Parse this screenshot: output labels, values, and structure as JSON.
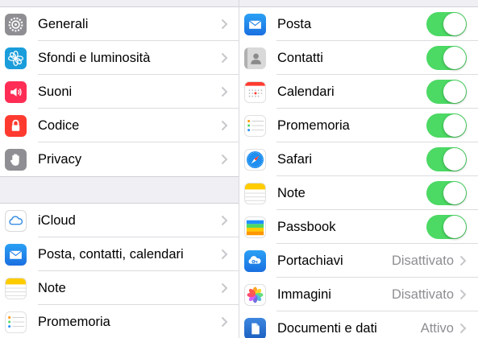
{
  "left": {
    "group1": [
      {
        "label": "Generali",
        "icon": "gear-icon",
        "color": "#8e8e93"
      },
      {
        "label": "Sfondi e luminosità",
        "icon": "flower-icon",
        "color": "#1a9ddb"
      },
      {
        "label": "Suoni",
        "icon": "speaker-icon",
        "color": "#ff2d55"
      },
      {
        "label": "Codice",
        "icon": "lock-icon",
        "color": "#ff3b30"
      },
      {
        "label": "Privacy",
        "icon": "hand-icon",
        "color": "#8e8e93"
      }
    ],
    "group2": [
      {
        "label": "iCloud",
        "icon": "cloud-icon",
        "color": "#ffffff"
      },
      {
        "label": "Posta, contatti, calendari",
        "icon": "mail-icon",
        "color": "#1e90ff"
      },
      {
        "label": "Note",
        "icon": "notes-icon",
        "color": "#ffcc00"
      },
      {
        "label": "Promemoria",
        "icon": "reminders-icon",
        "color": "#ffffff"
      }
    ]
  },
  "right": {
    "items": [
      {
        "label": "Posta",
        "icon": "mail-icon",
        "toggle": true
      },
      {
        "label": "Contatti",
        "icon": "contacts-icon",
        "toggle": true
      },
      {
        "label": "Calendari",
        "icon": "calendar-icon",
        "toggle": true
      },
      {
        "label": "Promemoria",
        "icon": "reminders-icon",
        "toggle": true
      },
      {
        "label": "Safari",
        "icon": "safari-icon",
        "toggle": true
      },
      {
        "label": "Note",
        "icon": "notes-icon",
        "toggle": true
      },
      {
        "label": "Passbook",
        "icon": "passbook-icon",
        "toggle": true
      },
      {
        "label": "Portachiavi",
        "icon": "keychain-icon",
        "value": "Disattivato"
      },
      {
        "label": "Immagini",
        "icon": "photos-icon",
        "value": "Disattivato"
      },
      {
        "label": "Documenti e dati",
        "icon": "documents-icon",
        "value": "Attivo"
      }
    ]
  },
  "colors": {
    "toggle_on": "#4cd964",
    "background": "#efeff4",
    "chevron": "#c7c7cc",
    "value_text": "#8e8e93"
  }
}
